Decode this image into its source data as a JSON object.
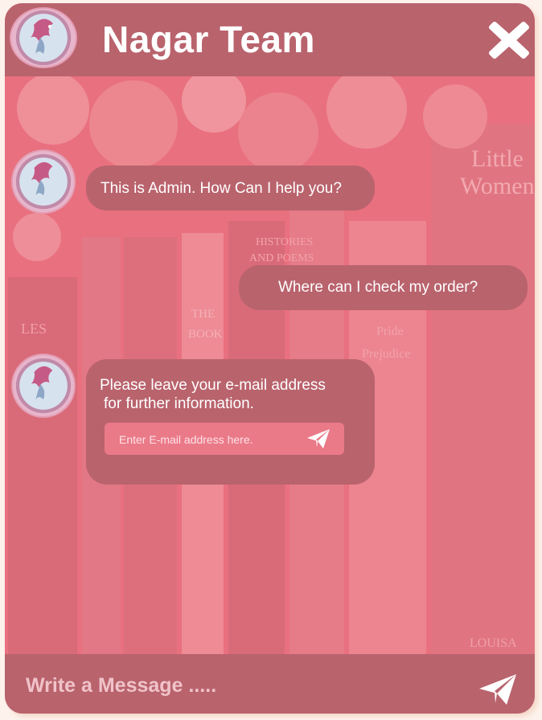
{
  "header": {
    "title": "Nagar Team",
    "avatar_icon": "dragon-avatar-icon",
    "close_icon": "close-icon"
  },
  "messages": [
    {
      "from": "admin",
      "text": "This is Admin. How Can  I help you?"
    },
    {
      "from": "user",
      "text": "Where can I check my order?"
    },
    {
      "from": "admin",
      "text_line1": "Please leave your e-mail address",
      "text_line2": "for further information."
    }
  ],
  "email_form": {
    "placeholder": "Enter E-mail address here.",
    "send_icon": "paper-plane-icon"
  },
  "composer": {
    "placeholder": "Write a Message .....",
    "send_icon": "paper-plane-icon"
  },
  "colors": {
    "header": "#b9636d",
    "background": "#e9707f",
    "bubble": "#b9636d",
    "email_field": "#ea7a88",
    "text": "#ffffff"
  }
}
